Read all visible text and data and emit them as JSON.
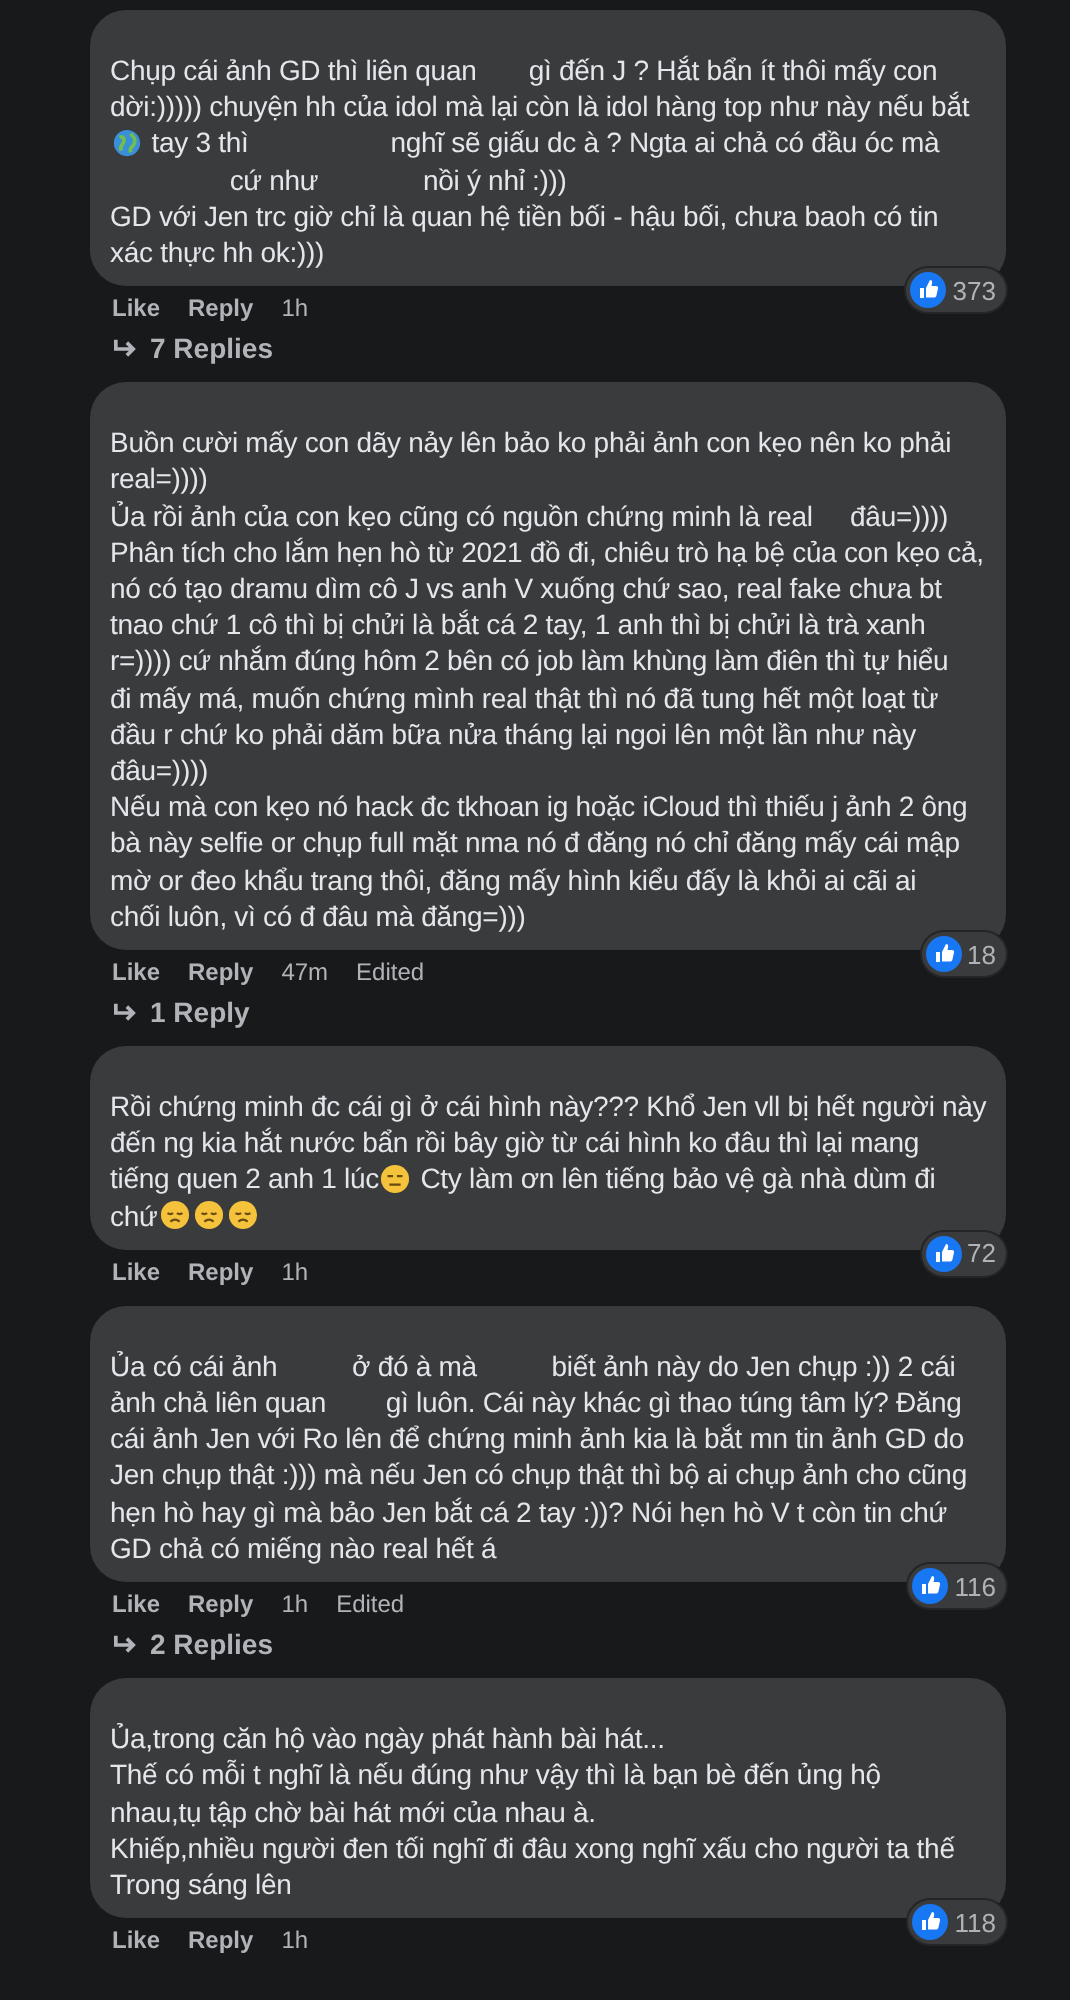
{
  "comments": [
    {
      "lines": [
        [
          {
            "kind": "text",
            "text": "Chụp cái ảnh GD thì liên quan       gì đến J ? Hắt bẩn ít thôi mấy con"
          }
        ],
        [
          {
            "kind": "text",
            "text": "dời:))))) chuyện hh của idol mà lại còn là idol hàng top như này nếu bắt"
          }
        ],
        [
          {
            "kind": "globe"
          },
          {
            "kind": "text",
            "text": " tay 3 thì                   nghĩ sẽ giấu dc à ? Ngta ai chả có đầu óc mà"
          }
        ],
        [
          {
            "kind": "text",
            "text": "                cứ như              nồi ý nhỉ :)))"
          }
        ],
        [
          {
            "kind": "text",
            "text": "GD với Jen trc giờ chỉ là quan hệ tiền bối - hậu bối, chưa baoh có tin"
          }
        ],
        [
          {
            "kind": "text",
            "text": "xác thực hh ok:)))"
          }
        ]
      ],
      "reactions": "373",
      "actions": [
        "Like",
        "Reply"
      ],
      "time": "1h",
      "replies": "7 Replies"
    },
    {
      "lines": [
        [
          {
            "kind": "text",
            "text": "Buồn cười mấy con dãy nảy lên bảo ko phải ảnh con kẹo nên ko phải"
          }
        ],
        [
          {
            "kind": "text",
            "text": "real=))))"
          }
        ],
        [
          {
            "kind": "text",
            "text": "Ủa rồi ảnh của con kẹo cũng có nguồn chứng minh là real     đâu=))))"
          }
        ],
        [
          {
            "kind": "text",
            "text": "Phân tích cho lắm hẹn hò từ 2021 đồ đi, chiêu trò hạ bệ của con kẹo cả,"
          }
        ],
        [
          {
            "kind": "text",
            "text": "nó có tạo dramu dìm cô J vs anh V xuống chứ sao, real fake chưa bt"
          }
        ],
        [
          {
            "kind": "text",
            "text": "tnao chứ 1 cô thì bị chửi là bắt cá 2 tay, 1 anh thì bị chửi là trà xanh"
          }
        ],
        [
          {
            "kind": "text",
            "text": "r=)))) cứ nhắm đúng hôm 2 bên có job làm khùng làm điên thì tự hiểu"
          }
        ],
        [
          {
            "kind": "text",
            "text": "đi mấy má, muốn chứng mình real thật thì nó đã tung hết một loạt từ"
          }
        ],
        [
          {
            "kind": "text",
            "text": "đầu r chứ ko phải dăm bữa nửa tháng lại ngoi lên một lần như này"
          }
        ],
        [
          {
            "kind": "text",
            "text": "đâu=))))"
          }
        ],
        [
          {
            "kind": "text",
            "text": "Nếu mà con kẹo nó hack đc tkhoan ig hoặc iCloud thì thiếu j ảnh 2 ông"
          }
        ],
        [
          {
            "kind": "text",
            "text": "bà này selfie or chụp full mặt nma nó đ đăng nó chỉ đăng mấy cái mập"
          }
        ],
        [
          {
            "kind": "text",
            "text": "mờ or đeo khẩu trang thôi, đăng mấy hình kiểu đấy là khỏi ai cãi ai"
          }
        ],
        [
          {
            "kind": "text",
            "text": "chối luôn, vì có đ đâu mà đăng=)))"
          }
        ]
      ],
      "reactions": "18",
      "actions": [
        "Like",
        "Reply"
      ],
      "time": "47m",
      "edited": "Edited",
      "replies": "1 Reply"
    },
    {
      "lines": [
        [
          {
            "kind": "text",
            "text": "Rồi chứng minh đc cái gì ở cái hình này??? Khổ Jen vll bị hết người này"
          }
        ],
        [
          {
            "kind": "text",
            "text": "đến ng kia hắt nước bẩn rồi bây giờ từ cái hình ko đâu thì lại mang"
          }
        ],
        [
          {
            "kind": "text",
            "text": "tiếng quen 2 anh 1 lúc"
          },
          {
            "kind": "meh"
          },
          {
            "kind": "text",
            "text": " Cty làm ơn lên tiếng bảo vệ gà nhà dùm đi"
          }
        ],
        [
          {
            "kind": "text",
            "text": "chứ"
          },
          {
            "kind": "sad"
          },
          {
            "kind": "sad"
          },
          {
            "kind": "sad"
          }
        ]
      ],
      "reactions": "72",
      "actions": [
        "Like",
        "Reply"
      ],
      "time": "1h"
    },
    {
      "lines": [
        [
          {
            "kind": "text",
            "text": "Ủa có cái ảnh          ở đó à mà          biết ảnh này do Jen chụp :)) 2 cái"
          }
        ],
        [
          {
            "kind": "text",
            "text": "ảnh chả liên quan        gì luôn. Cái này khác gì thao túng tâm lý? Đăng"
          }
        ],
        [
          {
            "kind": "text",
            "text": "cái ảnh Jen với Ro lên để chứng minh ảnh kia là bắt mn tin ảnh GD do"
          }
        ],
        [
          {
            "kind": "text",
            "text": "Jen chụp thật :))) mà nếu Jen có chụp thật thì bộ ai chụp ảnh cho cũng"
          }
        ],
        [
          {
            "kind": "text",
            "text": "hẹn hò hay gì mà bảo Jen bắt cá 2 tay :))? Nói hẹn hò V t còn tin chứ"
          }
        ],
        [
          {
            "kind": "text",
            "text": "GD chả có miếng nào real hết á"
          }
        ]
      ],
      "reactions": "116",
      "actions": [
        "Like",
        "Reply"
      ],
      "time": "1h",
      "edited": "Edited",
      "replies": "2 Replies"
    },
    {
      "lines": [
        [
          {
            "kind": "text",
            "text": "Ủa,trong căn hộ vào ngày phát hành bài hát..."
          }
        ],
        [
          {
            "kind": "text",
            "text": "Thế có mỗi t nghĩ là nếu đúng như vậy thì là bạn bè đến ủng hộ"
          }
        ],
        [
          {
            "kind": "text",
            "text": "nhau,tụ tập chờ bài hát mới của nhau à."
          }
        ],
        [
          {
            "kind": "text",
            "text": "Khiếp,nhiều người đen tối nghĩ đi đâu xong nghĩ xấu cho người ta thế"
          }
        ],
        [
          {
            "kind": "text",
            "text": "Trong sáng lên"
          }
        ]
      ],
      "reactions": "118",
      "actions": [
        "Like",
        "Reply"
      ],
      "time": "1h"
    }
  ]
}
